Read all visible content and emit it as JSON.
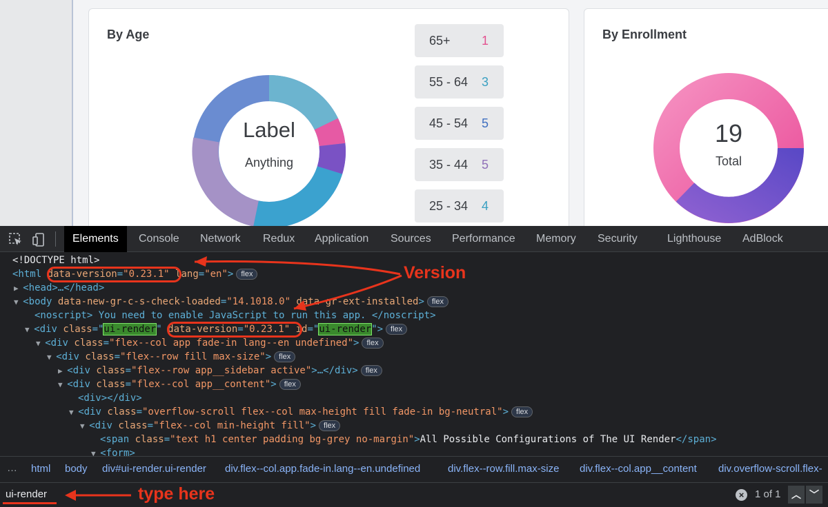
{
  "app": {
    "age_card": {
      "title": "By Age",
      "donut_label": "Label",
      "donut_sublabel": "Anything",
      "groups": [
        {
          "range": "65+",
          "count": "1",
          "color": "#e3518f"
        },
        {
          "range": "55 - 64",
          "count": "3",
          "color": "#3aa0c2"
        },
        {
          "range": "45 - 54",
          "count": "5",
          "color": "#3f6fc0"
        },
        {
          "range": "35 - 44",
          "count": "5",
          "color": "#9070b8"
        },
        {
          "range": "25 - 34",
          "count": "4",
          "color": "#3aa0c2"
        }
      ]
    },
    "enrollment_card": {
      "title": "By Enrollment",
      "total": "19",
      "total_label": "Total"
    }
  },
  "devtools": {
    "tabs": [
      "Elements",
      "Console",
      "Network",
      "Redux",
      "Application",
      "Sources",
      "Performance",
      "Memory",
      "Security",
      "Lighthouse",
      "AdBlock"
    ],
    "active_tab": "Elements",
    "badge_flex": "flex",
    "lines": {
      "doctype": "<!DOCTYPE html>",
      "html_open": "<html ",
      "html_attr1_name": "data-version",
      "html_attr1_val": "\"0.23.1\"",
      "html_attr2_name": " lang",
      "html_attr2_val": "\"en\"",
      "head": "<head>…</head>",
      "body_open": "<body ",
      "body_attr1_name": "data-new-gr-c-s-check-loaded",
      "body_attr1_val": "\"14.1018.0\"",
      "body_attr2_name": " data-gr-ext-installed",
      "noscript": "<noscript> You need to enable JavaScript to run this app. </noscript>",
      "div_ui_open": "<div ",
      "div_ui_class": "class",
      "div_ui_class_val": "ui-render",
      "div_ui_version_name": "data-version",
      "div_ui_version_val": "\"0.23.1\"",
      "div_ui_id": " id",
      "div_ui_id_val": "ui-render",
      "l6_name": "class",
      "l6_val": "\"flex--col app fade-in lang--en undefined\"",
      "l7_val": "\"flex--row fill max-size\"",
      "l8_val": "\"flex--row app__sidebar active\"",
      "l9_val": "\"flex--col app__content\"",
      "l10": "<div></div>",
      "l11_val": "\"overflow-scroll flex--col max-height fill fade-in bg-neutral\"",
      "l12_val": "\"flex--col min-height fill\"",
      "l13_val": "\"text h1 center padding bg-grey no-margin\"",
      "l13_text": "All Possible Configurations of The UI Render",
      "l14": "<form>"
    },
    "breadcrumbs": [
      "html",
      "body",
      "div#ui-render.ui-render",
      "div.flex--col.app.fade-in.lang--en.undefined",
      "div.flex--row.fill.max-size",
      "div.flex--col.app__content",
      "div.overflow-scroll.flex-"
    ],
    "search": {
      "value": "ui-render",
      "match": "1 of 1"
    }
  },
  "annotations": {
    "version": "Version",
    "type_here": "type here",
    "color": "#e8341c"
  }
}
